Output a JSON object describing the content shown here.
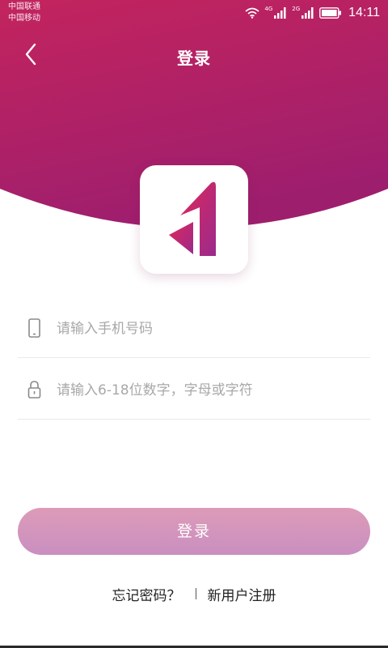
{
  "status_bar": {
    "carriers": [
      "中国联通",
      "中国移动"
    ],
    "network_labels": [
      "4G",
      "2G"
    ],
    "time": "14:11"
  },
  "header": {
    "title": "登录",
    "back_icon": "chevron-left-icon"
  },
  "logo": {
    "icon": "app-logo-icon"
  },
  "form": {
    "phone": {
      "icon": "phone-icon",
      "value": "",
      "placeholder": "请输入手机号码"
    },
    "password": {
      "icon": "lock-icon",
      "value": "",
      "placeholder": "请输入6-18位数字，字母或字符"
    },
    "submit_label": "登录"
  },
  "links": {
    "forgot_password": "忘记密码？",
    "register": "新用户注册"
  },
  "colors": {
    "header_top": "#c3245e",
    "header_bottom": "#a01e6c",
    "button_top": "#dd9bb8",
    "button_bottom": "#c98fc0"
  }
}
